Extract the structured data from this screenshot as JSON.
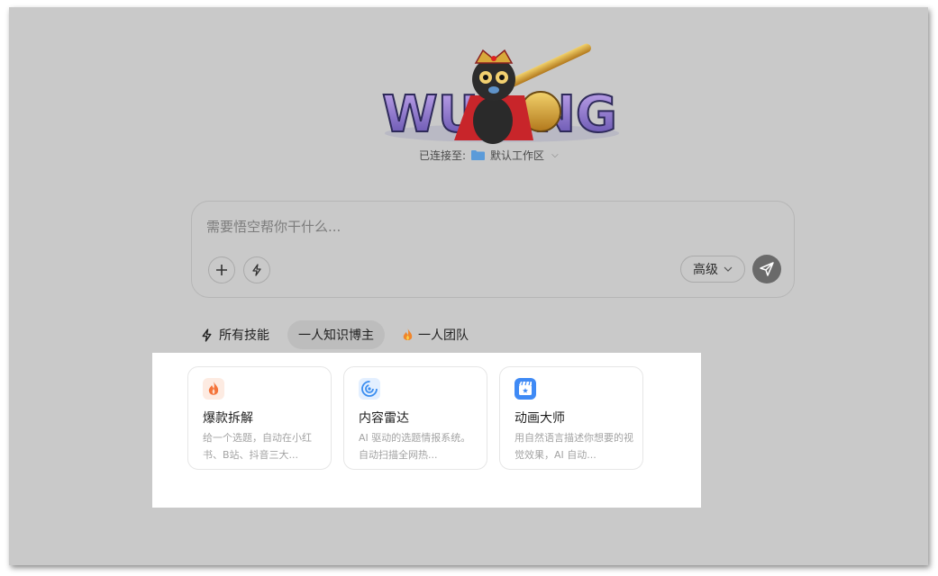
{
  "header": {
    "connected_label": "已连接至:",
    "workspace_name": "默认工作区"
  },
  "composer": {
    "placeholder": "需要悟空帮你干什么...",
    "advanced_label": "高级"
  },
  "tabs": [
    {
      "label": "所有技能",
      "icon": "lightning-icon"
    },
    {
      "label": "一人知识博主",
      "active": true
    },
    {
      "label": "一人团队",
      "icon": "fire-emoji-icon"
    }
  ],
  "cards": [
    {
      "title": "爆款拆解",
      "desc": "给一个选题，自动在小红书、B站、抖音三大...",
      "icon": "fire-icon",
      "color": "#f4743b"
    },
    {
      "title": "内容雷达",
      "desc": "AI 驱动的选题情报系统。自动扫描全网热...",
      "icon": "radar-icon",
      "color": "#3b8ef0"
    },
    {
      "title": "动画大师",
      "desc": "用自然语言描述你想要的视觉效果，AI 自动...",
      "icon": "clapperboard-icon",
      "color": "#3f8af5"
    }
  ],
  "logo": {
    "text": "WUKONG"
  },
  "colors": {
    "accent_orange": "#f4743b",
    "accent_blue": "#3b8ef0",
    "send_button": "#6a6a6a"
  }
}
